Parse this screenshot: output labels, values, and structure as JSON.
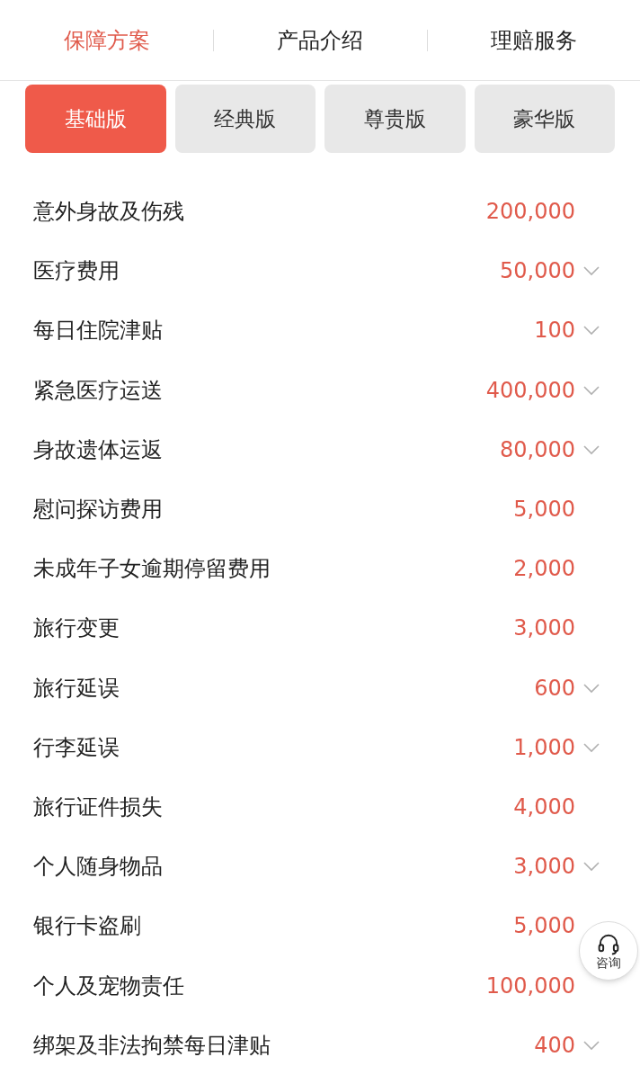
{
  "nav_tabs": [
    {
      "label": "保障方案",
      "selected": true
    },
    {
      "label": "产品介绍",
      "selected": false
    },
    {
      "label": "理赔服务",
      "selected": false
    }
  ],
  "plans": [
    {
      "label": "基础版",
      "selected": true
    },
    {
      "label": "经典版",
      "selected": false
    },
    {
      "label": "尊贵版",
      "selected": false
    },
    {
      "label": "豪华版",
      "selected": false
    }
  ],
  "coverage": [
    {
      "name": "意外身故及伤残",
      "amount": "200,000",
      "expandable": false
    },
    {
      "name": "医疗费用",
      "amount": "50,000",
      "expandable": true
    },
    {
      "name": "每日住院津贴",
      "amount": "100",
      "expandable": true
    },
    {
      "name": "紧急医疗运送",
      "amount": "400,000",
      "expandable": true
    },
    {
      "name": "身故遗体运返",
      "amount": "80,000",
      "expandable": true
    },
    {
      "name": "慰问探访费用",
      "amount": "5,000",
      "expandable": false
    },
    {
      "name": "未成年子女逾期停留费用",
      "amount": "2,000",
      "expandable": false
    },
    {
      "name": "旅行变更",
      "amount": "3,000",
      "expandable": false
    },
    {
      "name": "旅行延误",
      "amount": "600",
      "expandable": true
    },
    {
      "name": "行李延误",
      "amount": "1,000",
      "expandable": true
    },
    {
      "name": "旅行证件损失",
      "amount": "4,000",
      "expandable": false
    },
    {
      "name": "个人随身物品",
      "amount": "3,000",
      "expandable": true
    },
    {
      "name": "银行卡盗刷",
      "amount": "5,000",
      "expandable": false
    },
    {
      "name": "个人及宠物责任",
      "amount": "100,000",
      "expandable": false
    },
    {
      "name": "绑架及非法拘禁每日津贴",
      "amount": "400",
      "expandable": true
    }
  ],
  "consult_button": {
    "label": "咨询"
  }
}
